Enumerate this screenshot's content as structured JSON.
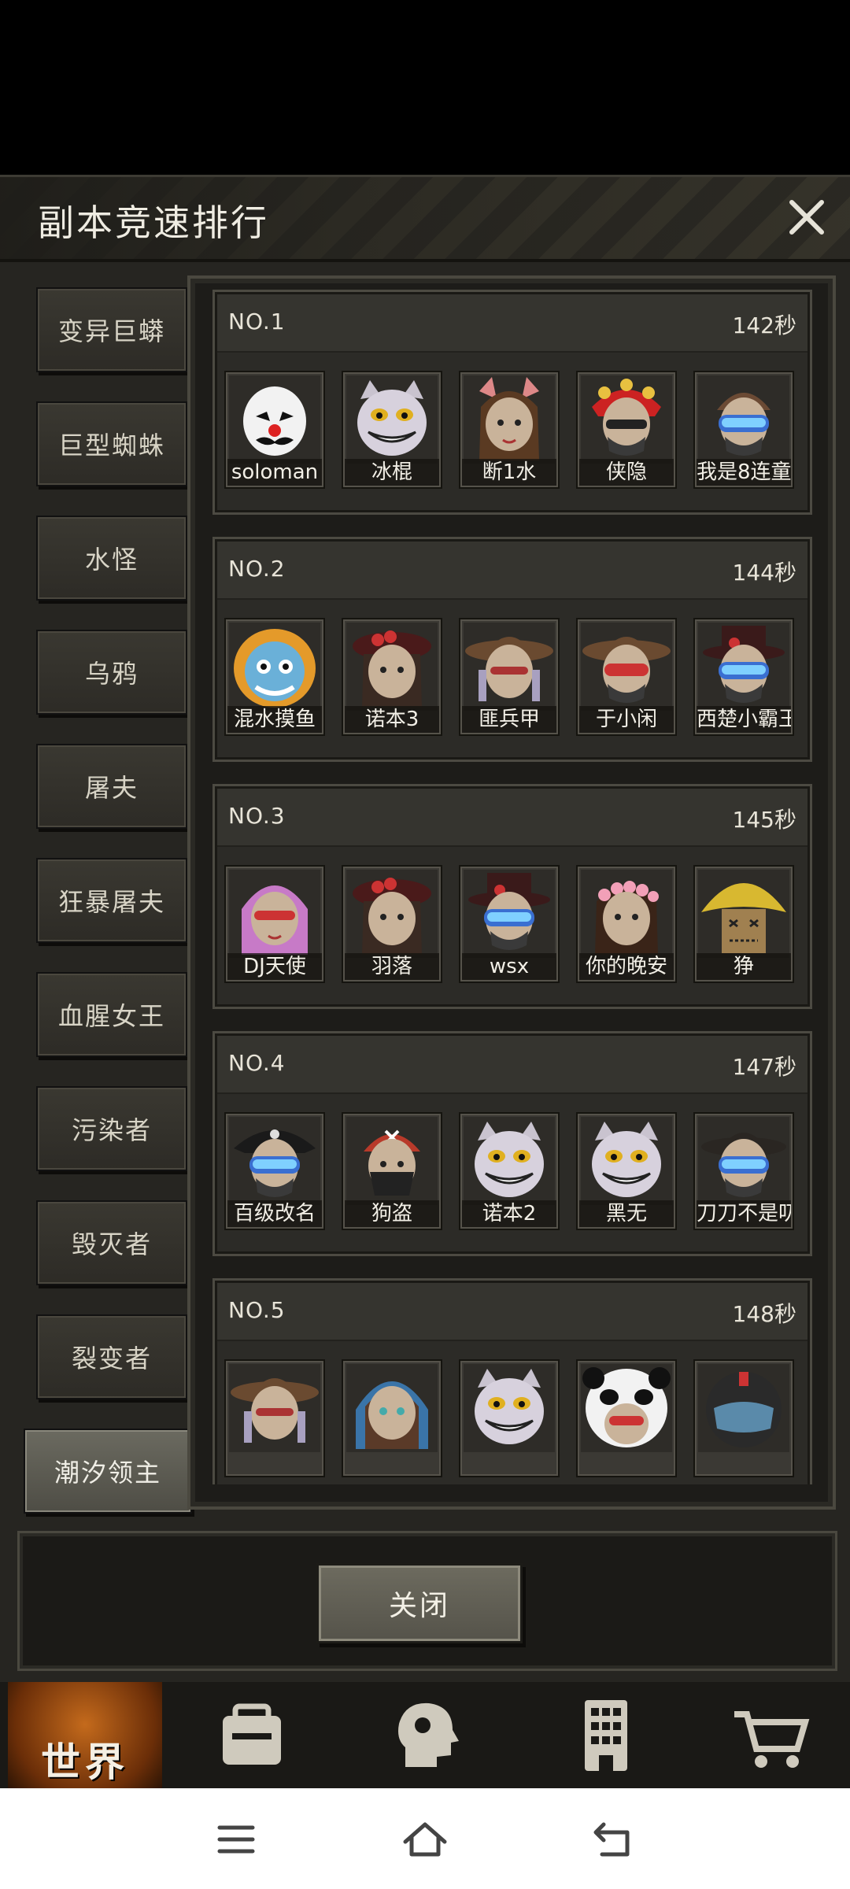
{
  "dialog": {
    "title": "副本竞速排行",
    "close_label": "关闭"
  },
  "tabs": [
    {
      "label": "变异巨蟒",
      "active": false
    },
    {
      "label": "巨型蜘蛛",
      "active": false
    },
    {
      "label": "水怪",
      "active": false
    },
    {
      "label": "乌鸦",
      "active": false
    },
    {
      "label": "屠夫",
      "active": false
    },
    {
      "label": "狂暴屠夫",
      "active": false
    },
    {
      "label": "血腥女王",
      "active": false
    },
    {
      "label": "污染者",
      "active": false
    },
    {
      "label": "毁灭者",
      "active": false
    },
    {
      "label": "裂变者",
      "active": false
    },
    {
      "label": "潮汐领主",
      "active": true
    }
  ],
  "rankings": [
    {
      "rank": "NO.1",
      "time": "142秒",
      "members": [
        {
          "name": "soloman",
          "avatar": "clown-mask-icon"
        },
        {
          "name": "冰棍",
          "avatar": "cat-grin-icon"
        },
        {
          "name": "断1水",
          "avatar": "girl-bunny-icon"
        },
        {
          "name": "侠隐",
          "avatar": "opera-headdress-icon"
        },
        {
          "name": "我是8连童",
          "avatar": "goggles-mask-icon"
        }
      ]
    },
    {
      "rank": "NO.2",
      "time": "144秒",
      "members": [
        {
          "name": "混水摸鱼",
          "avatar": "blue-lion-icon"
        },
        {
          "name": "诺本3",
          "avatar": "rose-hat-girl-icon"
        },
        {
          "name": "匪兵甲",
          "avatar": "cowboy-hat-icon"
        },
        {
          "name": "于小闲",
          "avatar": "cowboy-goggles-icon"
        },
        {
          "name": "西楚小霸王",
          "avatar": "top-hat-goggles-icon"
        }
      ]
    },
    {
      "rank": "NO.3",
      "time": "145秒",
      "members": [
        {
          "name": "DJ天使",
          "avatar": "pink-hair-icon"
        },
        {
          "name": "羽落",
          "avatar": "rose-hat-girl-icon"
        },
        {
          "name": "wsx",
          "avatar": "top-hat-goggles-icon"
        },
        {
          "name": "你的晚安",
          "avatar": "flower-crown-icon"
        },
        {
          "name": "狰",
          "avatar": "scarecrow-icon"
        }
      ]
    },
    {
      "rank": "NO.4",
      "time": "147秒",
      "members": [
        {
          "name": "百级改名",
          "avatar": "pirate-goggles-icon"
        },
        {
          "name": "狗盗",
          "avatar": "bandana-bandit-icon"
        },
        {
          "name": "诺本2",
          "avatar": "cat-grin-icon"
        },
        {
          "name": "黑无",
          "avatar": "cat-grin-icon"
        },
        {
          "name": "刀刀不是叨",
          "avatar": "fedora-goggles-icon"
        }
      ]
    },
    {
      "rank": "NO.5",
      "time": "148秒",
      "members": [
        {
          "name": "",
          "avatar": "cowboy-hat-icon"
        },
        {
          "name": "",
          "avatar": "blue-hood-girl-icon"
        },
        {
          "name": "",
          "avatar": "cat-grin-icon"
        },
        {
          "name": "",
          "avatar": "panda-hood-icon"
        },
        {
          "name": "",
          "avatar": "helmet-icon"
        }
      ]
    }
  ],
  "game_nav": {
    "world_label": "世界",
    "items": [
      "world-globe-icon",
      "backpack-icon",
      "head-gear-icon",
      "building-icon",
      "shop-cart-icon"
    ]
  },
  "system_nav": [
    "menu-icon",
    "home-icon",
    "back-icon"
  ],
  "colors": {
    "panel_bg": "#262521",
    "card_bg": "#2c2b27",
    "active_tab": "#6b6a60",
    "world_orange": "#c46a1c"
  }
}
